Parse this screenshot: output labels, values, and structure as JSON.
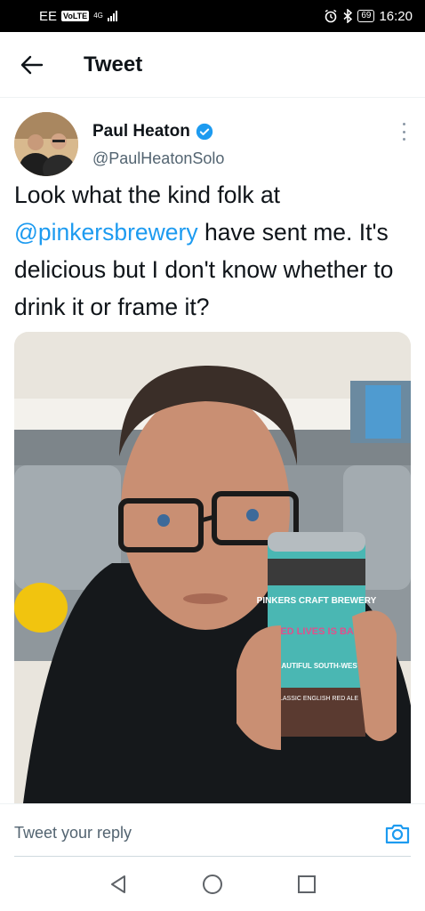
{
  "status_bar": {
    "carrier": "EE",
    "volte": "VoLTE",
    "network": "4G",
    "battery": "69",
    "time": "16:20",
    "icons": [
      "alarm-icon",
      "bluetooth-icon",
      "battery-icon",
      "signal-icon"
    ]
  },
  "header": {
    "title": "Tweet",
    "back_icon": "back-arrow-icon"
  },
  "tweet": {
    "author_name": "Paul Heaton",
    "author_handle": "@PaulHeatonSolo",
    "verified": true,
    "text_before": "Look what the kind folk at ",
    "mention": "@pinkersbrewery",
    "text_after": " have sent me. It's delicious but I don't know whether to drink it or frame it?",
    "photo": {
      "can_text_line1": "PINKERS CRAFT BREWERY",
      "can_text_line2": "FIXED LIVES IS BACK",
      "can_text_line3": "BEAUTIFUL SOUTH-WEST",
      "can_text_line4": "CLASSIC ENGLISH RED ALE"
    }
  },
  "reply": {
    "placeholder": "Tweet your reply",
    "camera_icon": "camera-icon"
  },
  "nav": {
    "items": [
      "back-nav-icon",
      "home-nav-icon",
      "recents-nav-icon"
    ]
  },
  "colors": {
    "accent": "#1d9bf0",
    "text": "#0f1419",
    "secondary": "#536471"
  }
}
